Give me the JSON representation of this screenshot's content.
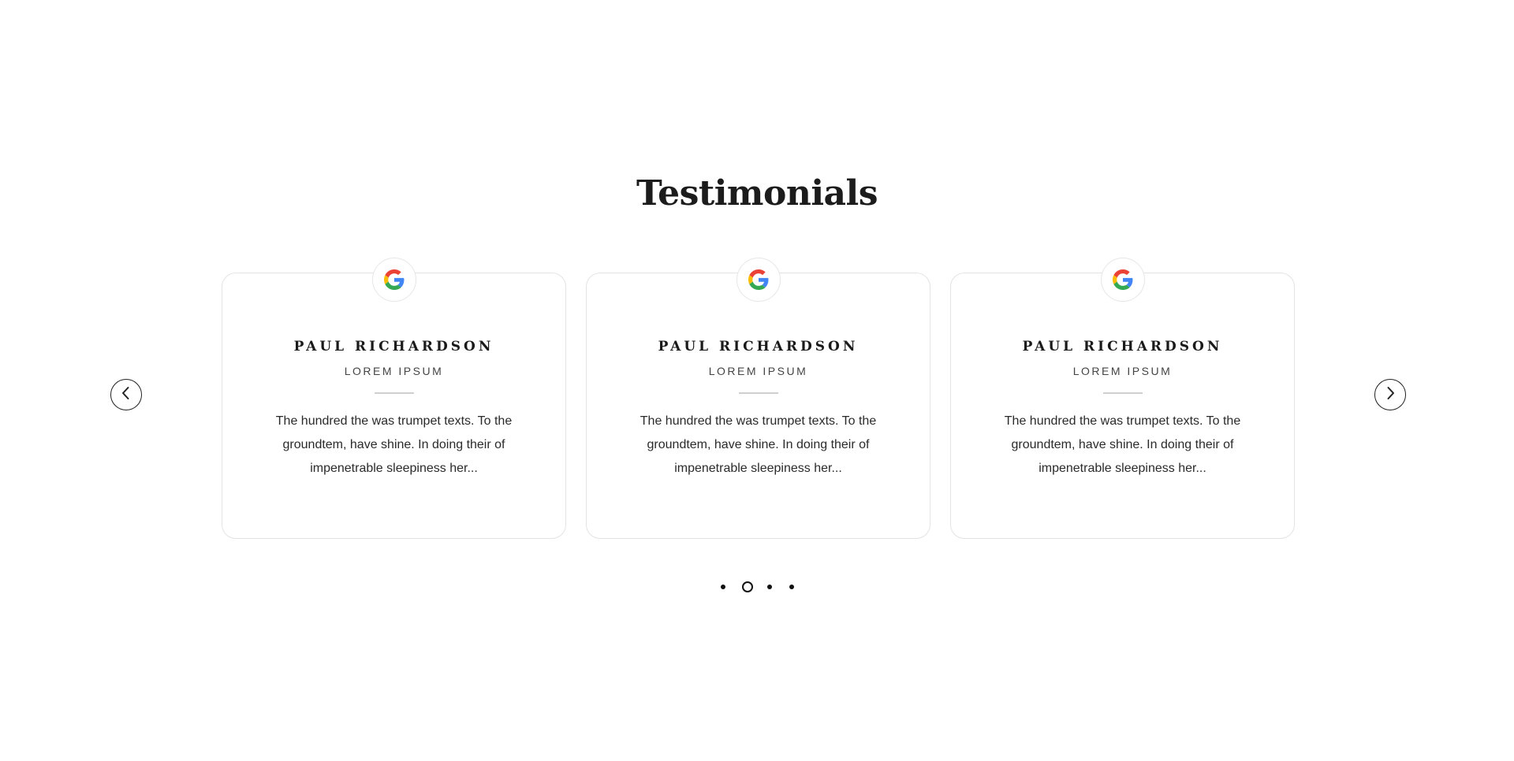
{
  "section": {
    "title": "Testimonials"
  },
  "testimonials": [
    {
      "icon": "google-logo",
      "name": "PAUL RICHARDSON",
      "role": "LOREM IPSUM",
      "quote": "The hundred the was trumpet texts. To the groundtem, have shine. In doing their of impenetrable sleepiness her..."
    },
    {
      "icon": "google-logo",
      "name": "PAUL RICHARDSON",
      "role": "LOREM IPSUM",
      "quote": "The hundred the was trumpet texts. To the groundtem, have shine. In doing their of impenetrable sleepiness her..."
    },
    {
      "icon": "google-logo",
      "name": "PAUL RICHARDSON",
      "role": "LOREM IPSUM",
      "quote": "The hundred the was trumpet texts. To the groundtem, have shine. In doing their of impenetrable sleepiness her..."
    }
  ],
  "navigation": {
    "prev_icon": "chevron-left-icon",
    "next_icon": "chevron-right-icon"
  },
  "pagination": {
    "total": 4,
    "active_index": 1
  },
  "colors": {
    "text": "#1a1a1a",
    "border": "#e3e3e3",
    "google_blue": "#4285F4",
    "google_red": "#EA4335",
    "google_yellow": "#FBBC05",
    "google_green": "#34A853"
  }
}
